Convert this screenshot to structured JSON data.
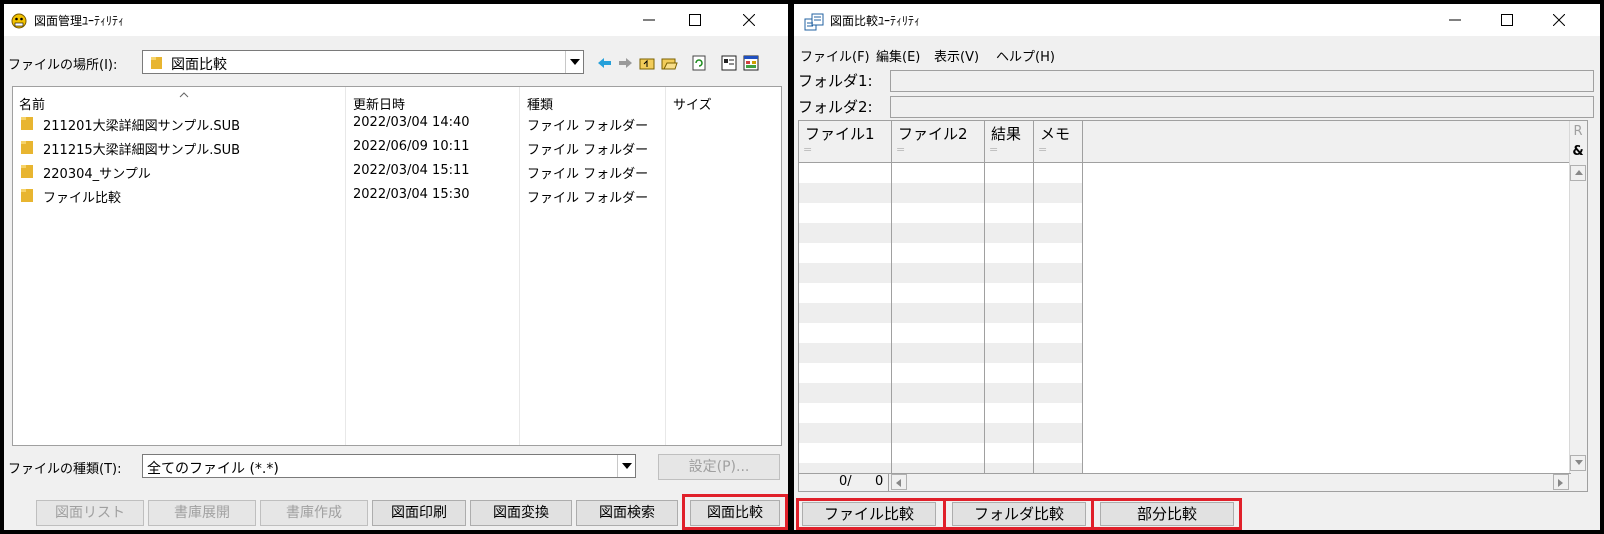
{
  "left_window": {
    "title": "図面管理ﾕｰﾃｨﾘﾃｨ",
    "location_label": "ファイルの場所(I):",
    "location_value": "図面比較",
    "columns": [
      "名前",
      "更新日時",
      "種類",
      "サイズ"
    ],
    "files": [
      {
        "name": "211201大梁詳細図サンプル.SUB",
        "date": "2022/03/04 14:40",
        "type": "ファイル フォルダー"
      },
      {
        "name": "211215大梁詳細図サンプル.SUB",
        "date": "2022/06/09 10:11",
        "type": "ファイル フォルダー"
      },
      {
        "name": "220304_サンプル",
        "date": "2022/03/04 15:11",
        "type": "ファイル フォルダー"
      },
      {
        "name": "ファイル比較",
        "date": "2022/03/04 15:30",
        "type": "ファイル フォルダー"
      }
    ],
    "filetype_label": "ファイルの種類(T):",
    "filetype_value": "全てのファイル (*.*)",
    "settings_button": "設定(P)...",
    "buttons": {
      "list": "図面リスト",
      "expand": "書庫展開",
      "create": "書庫作成",
      "print": "図面印刷",
      "convert": "図面変換",
      "search": "図面検索",
      "compare": "図面比較"
    }
  },
  "right_window": {
    "title": "図面比較ﾕｰﾃｨﾘﾃｨ",
    "menu": [
      "ファイル(F)",
      "編集(E)",
      "表示(V)",
      "ヘルプ(H)"
    ],
    "folder1_label": "フォルダ1:",
    "folder2_label": "フォルダ2:",
    "grid_columns": [
      "ファイル1",
      "ファイル2",
      "結果",
      "メモ"
    ],
    "grid_subtext": "=",
    "side_buttons": [
      "R",
      "&"
    ],
    "counter_current": "0/",
    "counter_total": "0",
    "buttons": {
      "file_compare": "ファイル比較",
      "folder_compare": "フォルダ比較",
      "partial_compare": "部分比較"
    }
  },
  "highlight_color": "#e0202a"
}
